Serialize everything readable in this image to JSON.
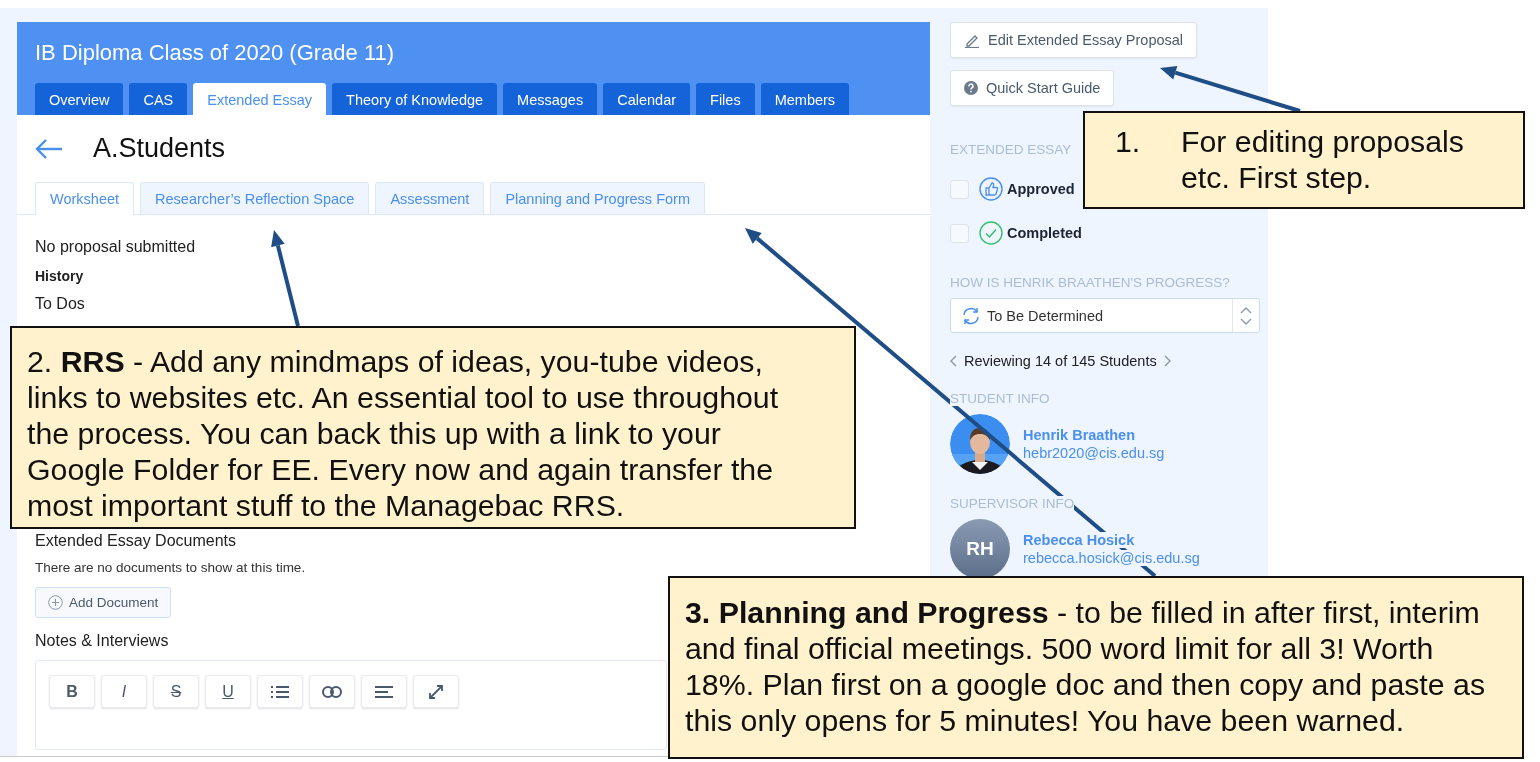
{
  "header": {
    "title": "IB Diploma Class of 2020 (Grade 11)",
    "tabs": [
      {
        "label": "Overview",
        "selected": false
      },
      {
        "label": "CAS",
        "selected": false
      },
      {
        "label": "Extended Essay",
        "selected": true
      },
      {
        "label": "Theory of Knowledge",
        "selected": false
      },
      {
        "label": "Messages",
        "selected": false
      },
      {
        "label": "Calendar",
        "selected": false
      },
      {
        "label": "Files",
        "selected": false
      },
      {
        "label": "Members",
        "selected": false
      }
    ]
  },
  "page": {
    "title": "A.Students",
    "subtabs": [
      {
        "label": "Worksheet",
        "selected": true
      },
      {
        "label": "Researcher’s Reflection Space",
        "selected": false
      },
      {
        "label": "Assessment",
        "selected": false
      },
      {
        "label": "Planning and Progress Form",
        "selected": false
      }
    ],
    "proposal_status": "No proposal submitted",
    "history": "History",
    "todos": "To Dos",
    "documents": {
      "title": "Extended Essay Documents",
      "empty": "There are no documents to show at this time.",
      "add_button": "Add Document"
    },
    "notes": {
      "title": "Notes & Interviews",
      "toolbar": [
        {
          "kind": "bold",
          "label": "B"
        },
        {
          "kind": "italic",
          "label": "I"
        },
        {
          "kind": "strike",
          "label": "S"
        },
        {
          "kind": "underline",
          "label": "U"
        },
        {
          "kind": "list"
        },
        {
          "kind": "link"
        },
        {
          "kind": "align"
        },
        {
          "kind": "expand"
        }
      ]
    }
  },
  "sidebar": {
    "buttons": [
      {
        "kind": "edit",
        "label": "Edit Extended Essay Proposal"
      },
      {
        "kind": "help",
        "label": "Quick Start Guide"
      }
    ],
    "status_label": "EXTENDED ESSAY",
    "statuses": [
      {
        "kind": "approved",
        "label": "Approved",
        "checked": false
      },
      {
        "kind": "completed",
        "label": "Completed",
        "checked": false
      }
    ],
    "progress_label": "HOW IS HENRIK BRAATHEN'S PROGRESS?",
    "progress_select": {
      "value": "To Be Determined"
    },
    "pager": "Reviewing 14 of 145 Students",
    "people": [
      {
        "heading": "STUDENT INFO",
        "name": "Henrik Braathen",
        "email": "hebr2020@cis.edu.sg"
      },
      {
        "heading": "SUPERVISOR INFO",
        "name": "Rebecca Hosick",
        "email": "rebecca.hosick@cis.edu.sg",
        "avatar": {
          "kind": "initials",
          "initials": "RH"
        }
      }
    ]
  },
  "callouts": [
    {
      "number": "1.",
      "text": "For editing proposals etc. First step."
    },
    {
      "text": "2. **RRS**  - Add any mindmaps of ideas, you-tube videos, links to websites etc. An essential tool to use throughout the process. You can back this up with a link to your Google Folder for EE. Every now and again transfer the most important stuff to the Managebac RRS."
    },
    {
      "text": "**3. Planning and Progress** - to be filled in after first, interim and final official meetings. 500 word limit for all 3! Worth 18%. Plan first on a google doc and then copy and paste as this only opens for 5 minutes! You have been warned."
    }
  ]
}
